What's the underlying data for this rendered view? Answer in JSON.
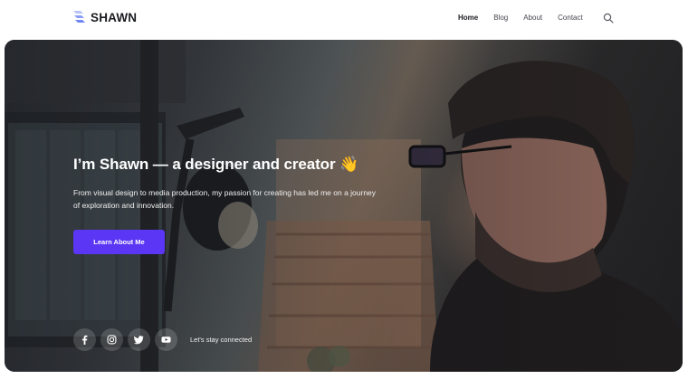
{
  "brand": {
    "name": "SHAWN"
  },
  "nav": {
    "items": [
      {
        "label": "Home",
        "active": true
      },
      {
        "label": "Blog",
        "active": false
      },
      {
        "label": "About",
        "active": false
      },
      {
        "label": "Contact",
        "active": false
      }
    ],
    "search_icon": "search-icon"
  },
  "hero": {
    "title": "I’m Shawn — a designer and creator 👋",
    "description": "From visual design to media production, my passion for creating has led me on a journey of exploration and innovation.",
    "cta_label": "Learn About Me",
    "social_label": "Let's stay connected",
    "socials": [
      "facebook-icon",
      "instagram-icon",
      "twitter-icon",
      "youtube-icon"
    ]
  },
  "colors": {
    "accent": "#5b36f5",
    "text_dark": "#1b1c20",
    "logo_blue": "#6f86f6"
  }
}
